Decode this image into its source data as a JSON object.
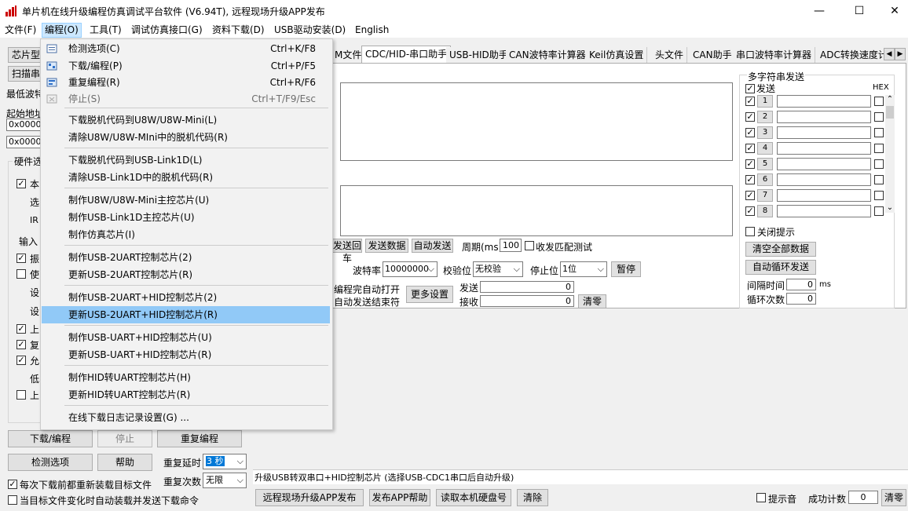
{
  "window": {
    "title": "单片机在线升级编程仿真调试平台软件 (V6.94T), 远程现场升级APP发布",
    "minimize": "—",
    "maximize": "☐",
    "close": "✕"
  },
  "menubar": [
    "文件(F)",
    "编程(O)",
    "工具(T)",
    "调试仿真接口(G)",
    "资料下载(D)",
    "USB驱动安装(D)",
    "English"
  ],
  "dropdown": {
    "items": [
      {
        "label": "检测选项(C)",
        "shortcut": "Ctrl+K/F8"
      },
      {
        "label": "下载/编程(P)",
        "shortcut": "Ctrl+P/F5"
      },
      {
        "label": "重复编程(R)",
        "shortcut": "Ctrl+R/F6"
      },
      {
        "label": "停止(S)",
        "shortcut": "Ctrl+T/F9/Esc"
      },
      {
        "label": "下载脱机代码到U8W/U8W-Mini(L)"
      },
      {
        "label": "清除U8W/U8W-MIni中的脱机代码(R)"
      },
      {
        "label": "下载脱机代码到USB-Link1D(L)"
      },
      {
        "label": "清除USB-Link1D中的脱机代码(R)"
      },
      {
        "label": "制作U8W/U8W-Mini主控芯片(U)"
      },
      {
        "label": "制作USB-Link1D主控芯片(U)"
      },
      {
        "label": "制作仿真芯片(I)"
      },
      {
        "label": "制作USB-2UART控制芯片(2)"
      },
      {
        "label": "更新USB-2UART控制芯片(R)"
      },
      {
        "label": "制作USB-2UART+HID控制芯片(2)"
      },
      {
        "label": "更新USB-2UART+HID控制芯片(R)"
      },
      {
        "label": "制作USB-UART+HID控制芯片(U)"
      },
      {
        "label": "更新USB-UART+HID控制芯片(R)"
      },
      {
        "label": "制作HID转UART控制芯片(H)"
      },
      {
        "label": "更新HID转UART控制芯片(R)"
      },
      {
        "label": "在线下载日志记录设置(G) ..."
      }
    ]
  },
  "left": {
    "chip_btn": "芯片型",
    "scan_btn": "扫描串",
    "baud_label": "最低波特",
    "start_addr_label": "起始地址",
    "addr1": "0x0000",
    "addr2": "0x0000",
    "hw_group": "硬件选",
    "opt_texts": [
      "本",
      "选",
      "IR",
      "输入",
      "振",
      "使",
      "设",
      "设",
      "上",
      "复",
      "允",
      "低",
      "上"
    ],
    "download_btn": "下载/编程",
    "stop_btn": "停止",
    "repeat_btn": "重复编程",
    "check_btn": "检测选项",
    "help_btn": "帮助",
    "repeat_delay_label": "重复延时",
    "repeat_delay_value": "3 秒",
    "repeat_count_label": "重复次数",
    "repeat_count_value": "无限",
    "reload_each": "每次下载前都重新装载目标文件",
    "auto_reload": "当目标文件变化时自动装载并发送下载命令"
  },
  "tabs": [
    "M文件",
    "CDC/HID-串口助手",
    "USB-HID助手",
    "CAN波特率计算器",
    "Keil仿真设置",
    "头文件",
    "CAN助手",
    "串口波特率计算器",
    "ADC转换速度计"
  ],
  "serial": {
    "send_back_btn": "发送回车",
    "send_data_btn": "发送数据",
    "auto_send_btn": "自动发送",
    "period_label": "周期(ms)",
    "period_value": "100",
    "recv_match": "收发匹配测试",
    "baud_label": "波特率",
    "baud_value": "10000000",
    "parity_label": "校验位",
    "parity_value": "无校验",
    "stop_label": "停止位",
    "stop_value": "1位",
    "pause_btn": "暂停",
    "auto_open_1": "编程完自动打开",
    "auto_open_2": "自动发送结束符",
    "more_btn": "更多设置",
    "send_label": "发送",
    "send_count": "0",
    "recv_label": "接收",
    "recv_count": "0",
    "clear_btn": "清零"
  },
  "multi": {
    "group": "多字符串发送",
    "send_header": "发送",
    "hex_header": "HEX",
    "rows": [
      "1",
      "2",
      "3",
      "4",
      "5",
      "6",
      "7",
      "8"
    ],
    "close_tip": "关闭提示",
    "clear_all_btn": "清空全部数据",
    "auto_loop_btn": "自动循环发送",
    "interval_label": "间隔时间",
    "interval_value": "0",
    "interval_unit": "ms",
    "loop_label": "循环次数",
    "loop_value": "0"
  },
  "status_text": "升级USB转双串口+HID控制芯片 (选择USB-CDC1串口后自动升级)",
  "bottom": {
    "remote_btn": "远程现场升级APP发布",
    "publish_help_btn": "发布APP帮助",
    "read_disk_btn": "读取本机硬盘号",
    "clear_btn": "清除",
    "sound_label": "提示音",
    "success_label": "成功计数",
    "success_value": "0",
    "clear_zero_btn": "清零"
  }
}
